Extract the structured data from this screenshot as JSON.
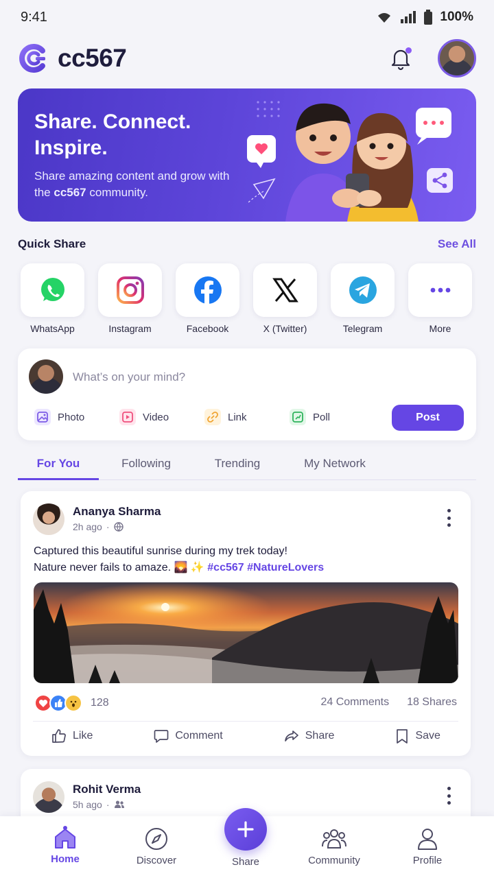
{
  "status_bar": {
    "time": "9:41",
    "battery": "100%"
  },
  "header": {
    "brand": "cc567"
  },
  "hero": {
    "title": "Share. Connect. Inspire.",
    "subtitle_before": "Share amazing content and grow with the ",
    "subtitle_brand": "cc567",
    "subtitle_after": " community."
  },
  "quick_share": {
    "title": "Quick Share",
    "see_all": "See All",
    "items": [
      {
        "label": "WhatsApp",
        "icon": "whatsapp-icon"
      },
      {
        "label": "Instagram",
        "icon": "instagram-icon"
      },
      {
        "label": "Facebook",
        "icon": "facebook-icon"
      },
      {
        "label": "X (Twitter)",
        "icon": "x-twitter-icon"
      },
      {
        "label": "Telegram",
        "icon": "telegram-icon"
      },
      {
        "label": "More",
        "icon": "more-dots-icon"
      }
    ]
  },
  "composer": {
    "placeholder": "What’s on your mind?",
    "actions": [
      {
        "label": "Photo",
        "icon": "photo-icon"
      },
      {
        "label": "Video",
        "icon": "video-icon"
      },
      {
        "label": "Link",
        "icon": "link-icon"
      },
      {
        "label": "Poll",
        "icon": "poll-icon"
      }
    ],
    "post_label": "Post"
  },
  "tabs": [
    {
      "label": "For You",
      "active": true
    },
    {
      "label": "Following"
    },
    {
      "label": "Trending"
    },
    {
      "label": "My Network"
    }
  ],
  "posts": [
    {
      "author": "Ananya Sharma",
      "time": "2h ago",
      "visibility_icon": "globe-icon",
      "text_line1": "Captured this beautiful sunrise during my trek today!",
      "text_line2": "Nature never fails to amaze. 🌄 ✨ ",
      "tags": "#cc567 #NatureLovers",
      "reaction_count": "128",
      "comments": "24 Comments",
      "shares": "18 Shares",
      "actions": [
        "Like",
        "Comment",
        "Share",
        "Save"
      ]
    },
    {
      "author": "Rohit Verma",
      "time": "5h ago",
      "visibility_icon": "friends-icon"
    }
  ],
  "bottom_nav": {
    "items": [
      "Home",
      "Discover",
      "Share",
      "Community",
      "Profile"
    ],
    "active": "Home"
  },
  "colors": {
    "accent": "#6546e4",
    "hero_start": "#4b37c7",
    "hero_end": "#7a5cf0"
  }
}
